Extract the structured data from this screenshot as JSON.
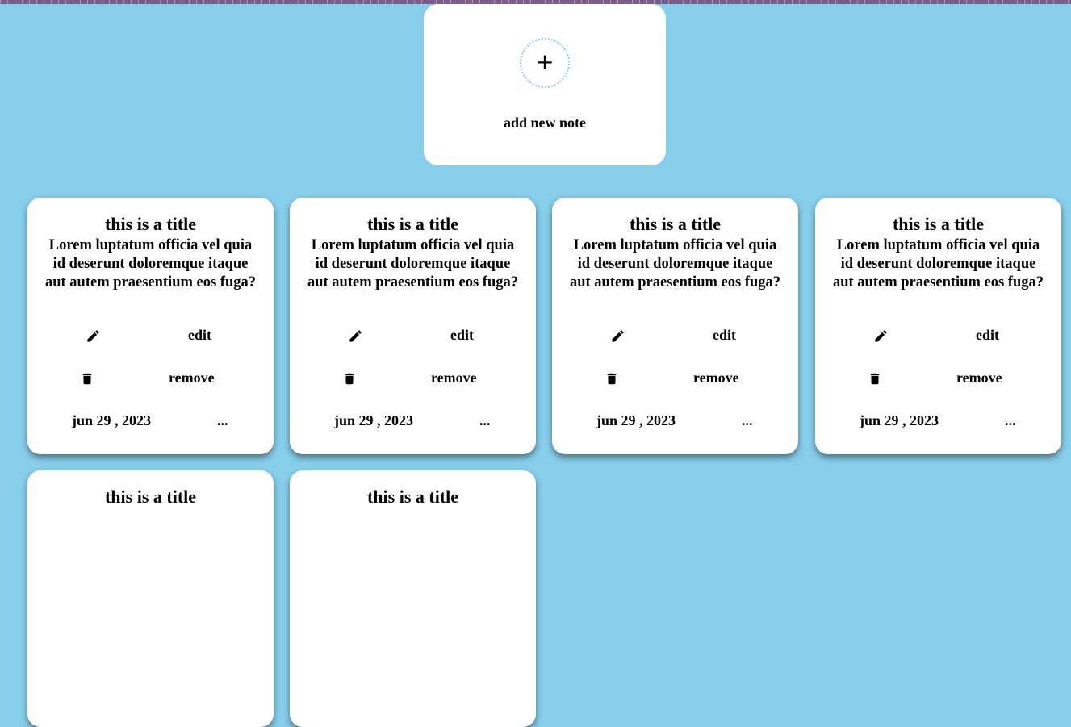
{
  "add_card": {
    "plus_symbol": "+",
    "label": "add new note"
  },
  "notes": [
    {
      "title": "this is a title",
      "body": "Lorem luptatum officia vel quia id deserunt doloremque itaque aut autem praesentium eos fuga?",
      "edit_label": "edit",
      "remove_label": "remove",
      "date": "jun 29 , 2023",
      "more": "..."
    },
    {
      "title": "this is a title",
      "body": "Lorem luptatum officia vel quia id deserunt doloremque itaque aut autem praesentium eos fuga?",
      "edit_label": "edit",
      "remove_label": "remove",
      "date": "jun 29 , 2023",
      "more": "..."
    },
    {
      "title": "this is a title",
      "body": "Lorem luptatum officia vel quia id deserunt doloremque itaque aut autem praesentium eos fuga?",
      "edit_label": "edit",
      "remove_label": "remove",
      "date": "jun 29 , 2023",
      "more": "..."
    },
    {
      "title": "this is a title",
      "body": "Lorem luptatum officia vel quia id deserunt doloremque itaque aut autem praesentium eos fuga?",
      "edit_label": "edit",
      "remove_label": "remove",
      "date": "jun 29 , 2023",
      "more": "..."
    },
    {
      "title": "this is a title"
    },
    {
      "title": "this is a title"
    }
  ],
  "icons": {
    "plus": "plus-icon",
    "edit": "pencil-icon",
    "remove": "trash-icon"
  },
  "colors": {
    "background": "#87ceeb",
    "card": "#ffffff",
    "dotted_border": "#87ceeb",
    "top_strip": "#7a5c8a"
  }
}
